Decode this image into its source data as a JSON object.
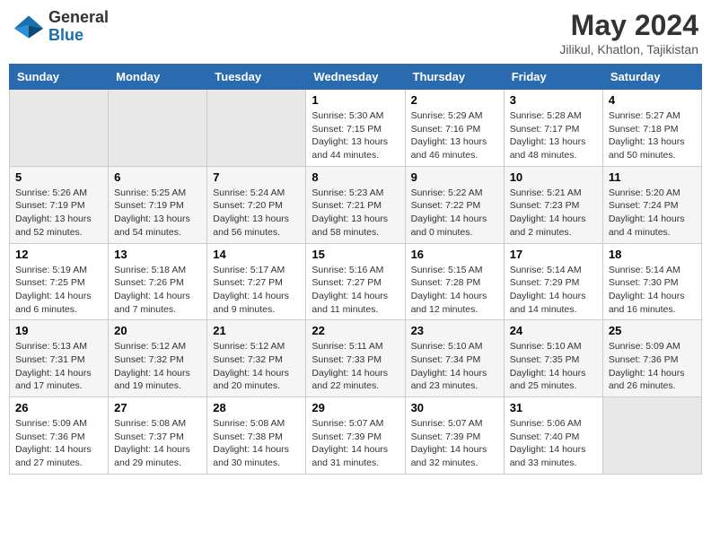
{
  "header": {
    "logo_general": "General",
    "logo_blue": "Blue",
    "month_title": "May 2024",
    "location": "Jilikul, Khatlon, Tajikistan"
  },
  "weekdays": [
    "Sunday",
    "Monday",
    "Tuesday",
    "Wednesday",
    "Thursday",
    "Friday",
    "Saturday"
  ],
  "weeks": [
    [
      {
        "day": "",
        "sunrise": "",
        "sunset": "",
        "daylight": ""
      },
      {
        "day": "",
        "sunrise": "",
        "sunset": "",
        "daylight": ""
      },
      {
        "day": "",
        "sunrise": "",
        "sunset": "",
        "daylight": ""
      },
      {
        "day": "1",
        "sunrise": "Sunrise: 5:30 AM",
        "sunset": "Sunset: 7:15 PM",
        "daylight": "Daylight: 13 hours and 44 minutes."
      },
      {
        "day": "2",
        "sunrise": "Sunrise: 5:29 AM",
        "sunset": "Sunset: 7:16 PM",
        "daylight": "Daylight: 13 hours and 46 minutes."
      },
      {
        "day": "3",
        "sunrise": "Sunrise: 5:28 AM",
        "sunset": "Sunset: 7:17 PM",
        "daylight": "Daylight: 13 hours and 48 minutes."
      },
      {
        "day": "4",
        "sunrise": "Sunrise: 5:27 AM",
        "sunset": "Sunset: 7:18 PM",
        "daylight": "Daylight: 13 hours and 50 minutes."
      }
    ],
    [
      {
        "day": "5",
        "sunrise": "Sunrise: 5:26 AM",
        "sunset": "Sunset: 7:19 PM",
        "daylight": "Daylight: 13 hours and 52 minutes."
      },
      {
        "day": "6",
        "sunrise": "Sunrise: 5:25 AM",
        "sunset": "Sunset: 7:19 PM",
        "daylight": "Daylight: 13 hours and 54 minutes."
      },
      {
        "day": "7",
        "sunrise": "Sunrise: 5:24 AM",
        "sunset": "Sunset: 7:20 PM",
        "daylight": "Daylight: 13 hours and 56 minutes."
      },
      {
        "day": "8",
        "sunrise": "Sunrise: 5:23 AM",
        "sunset": "Sunset: 7:21 PM",
        "daylight": "Daylight: 13 hours and 58 minutes."
      },
      {
        "day": "9",
        "sunrise": "Sunrise: 5:22 AM",
        "sunset": "Sunset: 7:22 PM",
        "daylight": "Daylight: 14 hours and 0 minutes."
      },
      {
        "day": "10",
        "sunrise": "Sunrise: 5:21 AM",
        "sunset": "Sunset: 7:23 PM",
        "daylight": "Daylight: 14 hours and 2 minutes."
      },
      {
        "day": "11",
        "sunrise": "Sunrise: 5:20 AM",
        "sunset": "Sunset: 7:24 PM",
        "daylight": "Daylight: 14 hours and 4 minutes."
      }
    ],
    [
      {
        "day": "12",
        "sunrise": "Sunrise: 5:19 AM",
        "sunset": "Sunset: 7:25 PM",
        "daylight": "Daylight: 14 hours and 6 minutes."
      },
      {
        "day": "13",
        "sunrise": "Sunrise: 5:18 AM",
        "sunset": "Sunset: 7:26 PM",
        "daylight": "Daylight: 14 hours and 7 minutes."
      },
      {
        "day": "14",
        "sunrise": "Sunrise: 5:17 AM",
        "sunset": "Sunset: 7:27 PM",
        "daylight": "Daylight: 14 hours and 9 minutes."
      },
      {
        "day": "15",
        "sunrise": "Sunrise: 5:16 AM",
        "sunset": "Sunset: 7:27 PM",
        "daylight": "Daylight: 14 hours and 11 minutes."
      },
      {
        "day": "16",
        "sunrise": "Sunrise: 5:15 AM",
        "sunset": "Sunset: 7:28 PM",
        "daylight": "Daylight: 14 hours and 12 minutes."
      },
      {
        "day": "17",
        "sunrise": "Sunrise: 5:14 AM",
        "sunset": "Sunset: 7:29 PM",
        "daylight": "Daylight: 14 hours and 14 minutes."
      },
      {
        "day": "18",
        "sunrise": "Sunrise: 5:14 AM",
        "sunset": "Sunset: 7:30 PM",
        "daylight": "Daylight: 14 hours and 16 minutes."
      }
    ],
    [
      {
        "day": "19",
        "sunrise": "Sunrise: 5:13 AM",
        "sunset": "Sunset: 7:31 PM",
        "daylight": "Daylight: 14 hours and 17 minutes."
      },
      {
        "day": "20",
        "sunrise": "Sunrise: 5:12 AM",
        "sunset": "Sunset: 7:32 PM",
        "daylight": "Daylight: 14 hours and 19 minutes."
      },
      {
        "day": "21",
        "sunrise": "Sunrise: 5:12 AM",
        "sunset": "Sunset: 7:32 PM",
        "daylight": "Daylight: 14 hours and 20 minutes."
      },
      {
        "day": "22",
        "sunrise": "Sunrise: 5:11 AM",
        "sunset": "Sunset: 7:33 PM",
        "daylight": "Daylight: 14 hours and 22 minutes."
      },
      {
        "day": "23",
        "sunrise": "Sunrise: 5:10 AM",
        "sunset": "Sunset: 7:34 PM",
        "daylight": "Daylight: 14 hours and 23 minutes."
      },
      {
        "day": "24",
        "sunrise": "Sunrise: 5:10 AM",
        "sunset": "Sunset: 7:35 PM",
        "daylight": "Daylight: 14 hours and 25 minutes."
      },
      {
        "day": "25",
        "sunrise": "Sunrise: 5:09 AM",
        "sunset": "Sunset: 7:36 PM",
        "daylight": "Daylight: 14 hours and 26 minutes."
      }
    ],
    [
      {
        "day": "26",
        "sunrise": "Sunrise: 5:09 AM",
        "sunset": "Sunset: 7:36 PM",
        "daylight": "Daylight: 14 hours and 27 minutes."
      },
      {
        "day": "27",
        "sunrise": "Sunrise: 5:08 AM",
        "sunset": "Sunset: 7:37 PM",
        "daylight": "Daylight: 14 hours and 29 minutes."
      },
      {
        "day": "28",
        "sunrise": "Sunrise: 5:08 AM",
        "sunset": "Sunset: 7:38 PM",
        "daylight": "Daylight: 14 hours and 30 minutes."
      },
      {
        "day": "29",
        "sunrise": "Sunrise: 5:07 AM",
        "sunset": "Sunset: 7:39 PM",
        "daylight": "Daylight: 14 hours and 31 minutes."
      },
      {
        "day": "30",
        "sunrise": "Sunrise: 5:07 AM",
        "sunset": "Sunset: 7:39 PM",
        "daylight": "Daylight: 14 hours and 32 minutes."
      },
      {
        "day": "31",
        "sunrise": "Sunrise: 5:06 AM",
        "sunset": "Sunset: 7:40 PM",
        "daylight": "Daylight: 14 hours and 33 minutes."
      },
      {
        "day": "",
        "sunrise": "",
        "sunset": "",
        "daylight": ""
      }
    ]
  ]
}
